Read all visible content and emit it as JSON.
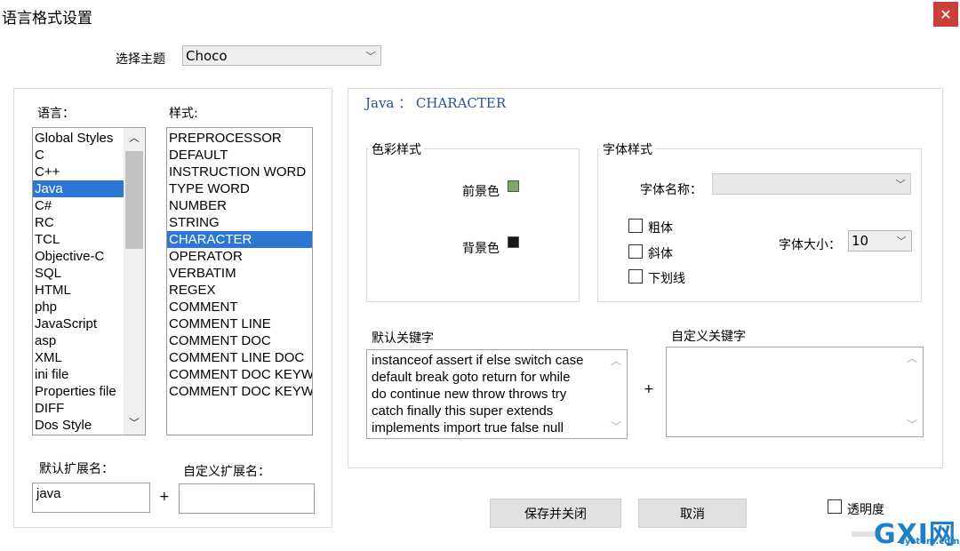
{
  "window": {
    "title": "语言格式设置",
    "close_glyph": "✕"
  },
  "theme": {
    "label": "选择主题",
    "value": "Choco",
    "chevron": "﹀"
  },
  "languages": {
    "label": "语言：",
    "items": [
      "Global Styles",
      "C",
      "C++",
      "Java",
      "C#",
      "RC",
      "TCL",
      "Objective-C",
      "SQL",
      "HTML",
      "php",
      "JavaScript",
      "asp",
      "XML",
      "ini file",
      "Properties file",
      "DIFF",
      "Dos Style"
    ],
    "selected": "Java",
    "scroll_up": "︿",
    "scroll_down": "﹀"
  },
  "styles": {
    "label": "样式:",
    "items": [
      "PREPROCESSOR",
      "DEFAULT",
      "INSTRUCTION WORD",
      "TYPE WORD",
      "NUMBER",
      "STRING",
      "CHARACTER",
      "OPERATOR",
      "VERBATIM",
      "REGEX",
      "COMMENT",
      "COMMENT LINE",
      "COMMENT DOC",
      "COMMENT LINE DOC",
      "COMMENT DOC KEYWC",
      "COMMENT DOC KEYWC"
    ],
    "selected": "CHARACTER"
  },
  "heading": "Java ： CHARACTER",
  "colors": {
    "label": "色彩样式",
    "fg_label": "前景色",
    "bg_label": "背景色",
    "fg_color": "#7fa865",
    "bg_color": "#1e1410"
  },
  "font": {
    "label": "字体样式",
    "name_label": "字体名称：",
    "name_value": "",
    "bold_label": "粗体",
    "italic_label": "斜体",
    "underline_label": "下划线",
    "size_label": "字体大小：",
    "size_value": "10"
  },
  "keywords": {
    "default_label": "默认关键字",
    "default_lines": [
      "instanceof assert if else switch case",
      "default break goto return for while",
      "do continue new throw throws try",
      "catch finally this super extends",
      "implements import true false null"
    ],
    "plus": "+",
    "custom_label": "自定义关键字",
    "custom_value": ""
  },
  "extensions": {
    "default_label": "默认扩展名：",
    "default_value": "java",
    "plus": "+",
    "custom_label": "自定义扩展名：",
    "custom_value": ""
  },
  "buttons": {
    "save": "保存并关闭",
    "cancel": "取消"
  },
  "transparency": {
    "label": "透明度"
  },
  "watermark": {
    "logo": "GXI网",
    "site": "system.com"
  },
  "accent": "#2d77d4"
}
